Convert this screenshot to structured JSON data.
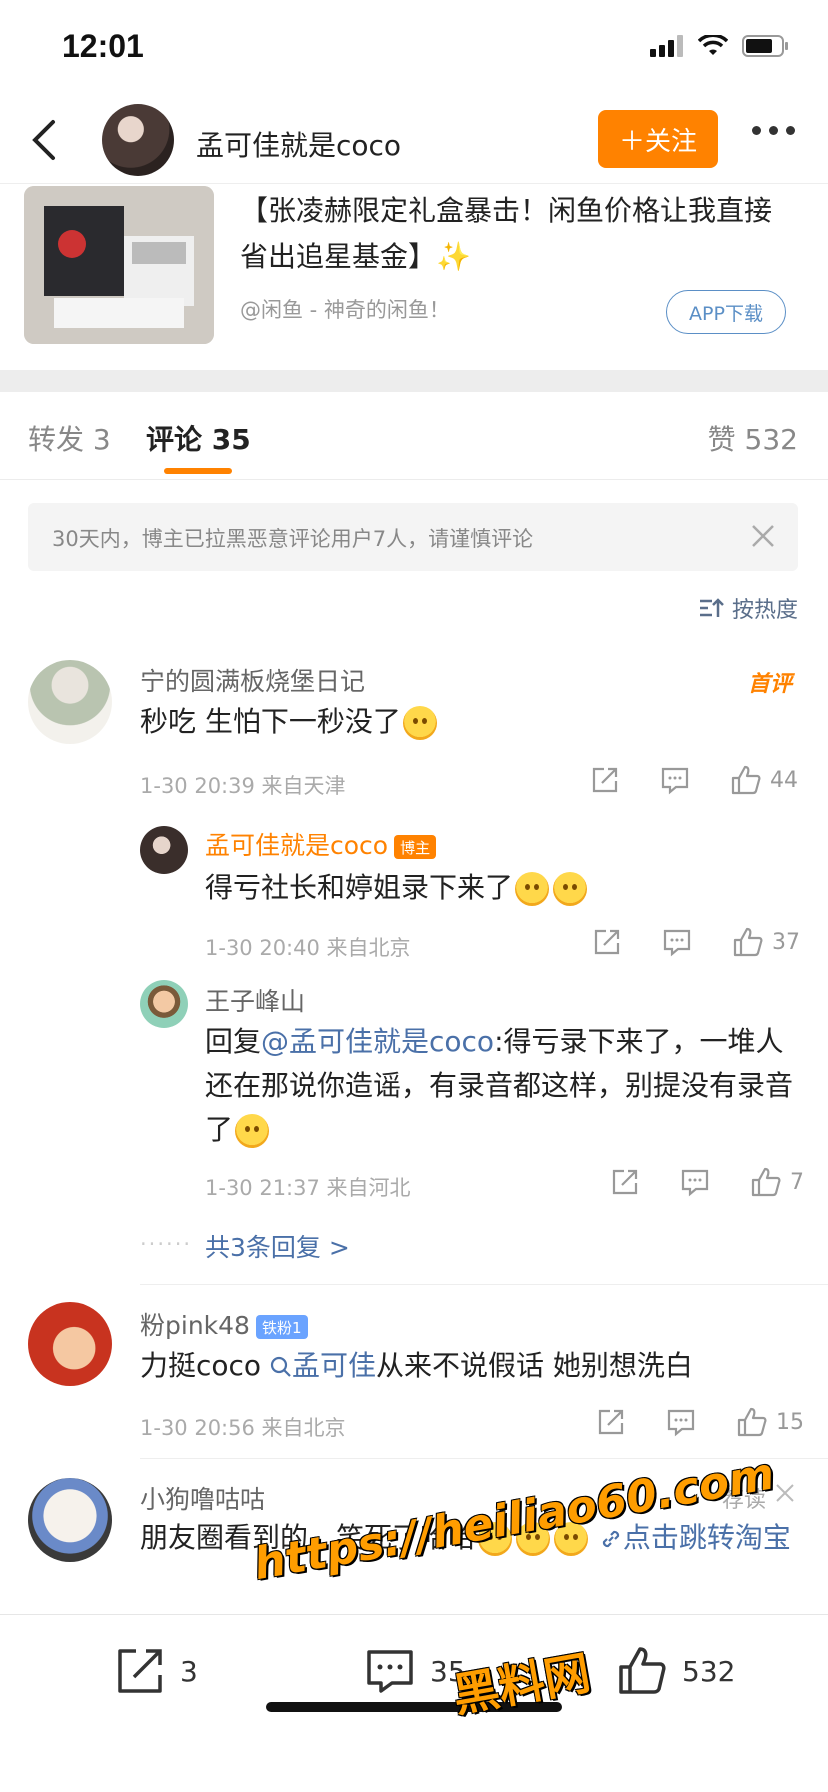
{
  "status": {
    "time": "12:01"
  },
  "header": {
    "username": "孟可佳就是coco",
    "follow_label": "＋关注"
  },
  "ad": {
    "title": "【张凌赫限定礼盒暴击！闲鱼价格让我直接省出追星基金】✨",
    "source": "@闲鱼 - 神奇的闲鱼！",
    "app_download": "APP下载"
  },
  "tabs": {
    "repost": "转发 3",
    "comments": "评论 35",
    "likes": "赞 532"
  },
  "notice": {
    "text": "30天内，博主已拉黑恶意评论用户7人，请谨慎评论"
  },
  "sort": {
    "label": "按热度"
  },
  "comments": [
    {
      "name": "宁的圆满板烧堡日记",
      "tag": "首评",
      "text": "秒吃 生怕下一秒没了",
      "meta": "1-30 20:39  来自天津",
      "likes": "44",
      "replies": [
        {
          "name": "孟可佳就是coco",
          "badge": "博主",
          "text": "得亏社长和婷姐录下来了",
          "meta": "1-30 20:40  来自北京",
          "likes": "37"
        },
        {
          "name": "王子峰山",
          "reply_prefix": "回复",
          "mention": "@孟可佳就是coco",
          "text": ":得亏录下来了，一堆人还在那说你造谣，有录音都这样，别提没有录音了",
          "meta": "1-30 21:37  来自河北",
          "likes": "7"
        }
      ],
      "more_replies": "共3条回复 >"
    },
    {
      "name": "粉pink48",
      "badge": "铁粉1",
      "text_prefix": "力挺coco ",
      "search_link": "孟可佳",
      "text_suffix": "从来不说假话 她别想洗白",
      "meta": "1-30 20:56  来自北京",
      "likes": "15"
    },
    {
      "name": "小狗噜咕咕",
      "tag": "荐读",
      "text": "朋友圈看到的，笑死了哈哈",
      "link": "点击跳转淘宝"
    }
  ],
  "bottombar": {
    "repost_count": "3",
    "comment_count": "35",
    "like_count": "532"
  },
  "watermark": {
    "line1": "https://heiliao60.com",
    "line2": "黑料网"
  },
  "colors": {
    "accent": "#ff8200",
    "link": "#4a70a8"
  }
}
